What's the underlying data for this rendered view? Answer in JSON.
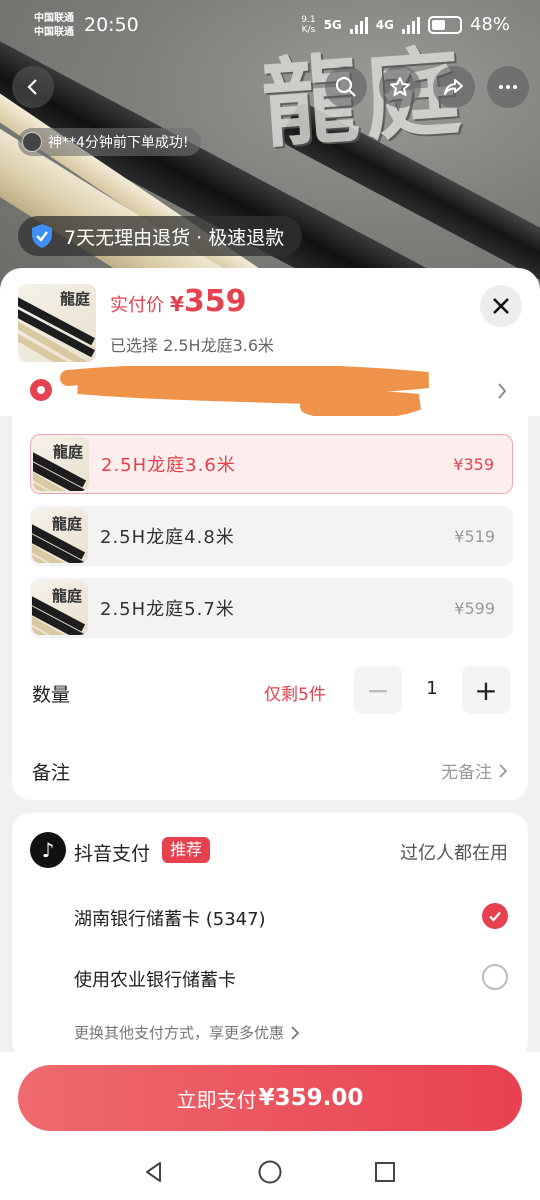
{
  "status_bar": {
    "carrier_1": "中国联通",
    "carrier_2": "中国联通",
    "time": "20:50",
    "net_speed_value": "9.1",
    "net_speed_unit": "K/s",
    "net_1": "5G",
    "net_2": "4G",
    "battery": "48%"
  },
  "hero": {
    "brand_text": "龍庭",
    "toast": "神**4分钟前下单成功!",
    "refund_banner": "7天无理由退货 · 极速退款"
  },
  "product": {
    "thumb_text": "龍庭",
    "price_label": "实付价",
    "currency": "¥",
    "price": "359",
    "selected_text": "已选择 2.5H龙庭3.6米"
  },
  "sku_options": [
    {
      "name": "2.5H龙庭3.6米",
      "price": "¥359",
      "selected": true
    },
    {
      "name": "2.5H龙庭4.8米",
      "price": "¥519",
      "selected": false
    },
    {
      "name": "2.5H龙庭5.7米",
      "price": "¥599",
      "selected": false
    }
  ],
  "quantity": {
    "label": "数量",
    "stock_text": "仅剩5件",
    "minus": "−",
    "value": "1",
    "plus": "+"
  },
  "remark": {
    "label": "备注",
    "value": "无备注"
  },
  "payment": {
    "provider_icon_text": "♪",
    "title": "抖音支付",
    "badge": "推荐",
    "tagline": "过亿人都在用",
    "options": [
      {
        "label": "湖南银行储蓄卡 (5347)",
        "selected": true
      },
      {
        "label": "使用农业银行储蓄卡",
        "selected": false
      }
    ],
    "more_text": "更换其他支付方式，享更多优惠"
  },
  "pay_button": {
    "label": "立即支付",
    "amount": "¥359.00"
  },
  "colors": {
    "accent": "#e5414e",
    "accent_light": "#fdeeee"
  }
}
